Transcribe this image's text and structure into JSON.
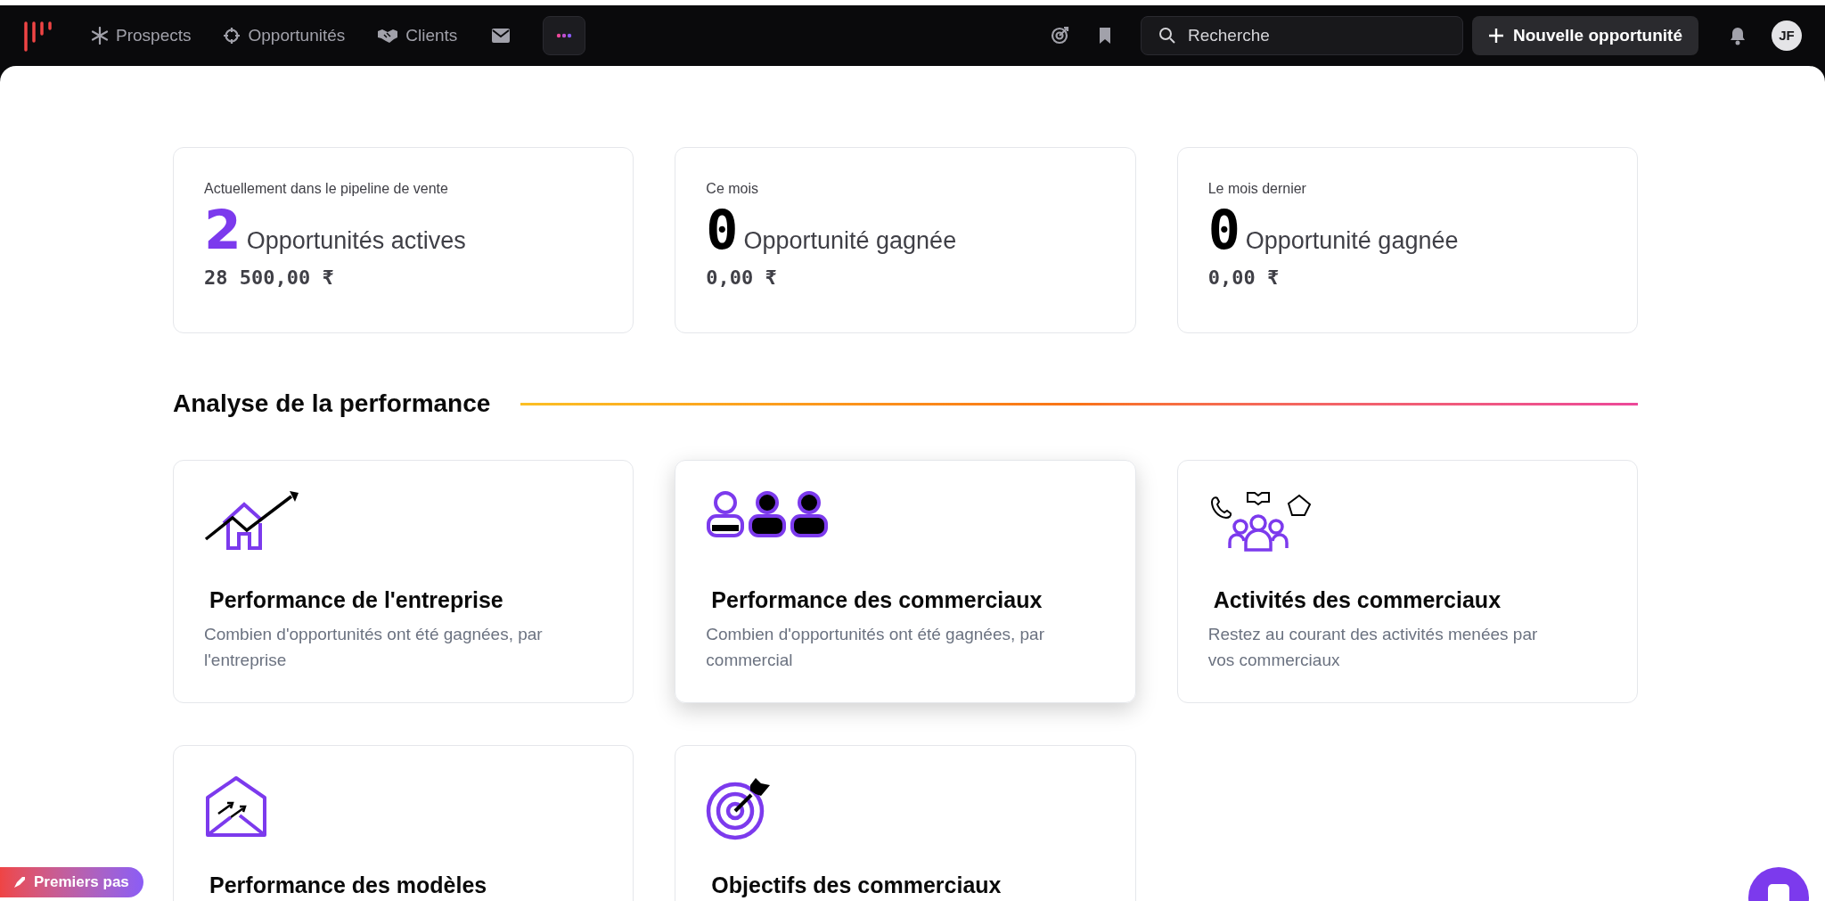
{
  "nav": {
    "items": [
      {
        "label": "Prospects"
      },
      {
        "label": "Opportunités"
      },
      {
        "label": "Clients"
      }
    ],
    "search": {
      "placeholder": "Recherche"
    },
    "new_button": "Nouvelle opportunité",
    "avatar": "JF"
  },
  "stats": [
    {
      "caption": "Actuellement dans le pipeline de vente",
      "count": "2",
      "highlighted": true,
      "label": "Opportunités actives",
      "amount": "28 500,00 ₹"
    },
    {
      "caption": "Ce mois",
      "count": "0",
      "highlighted": false,
      "label": "Opportunité gagnée",
      "amount": "0,00 ₹"
    },
    {
      "caption": "Le mois dernier",
      "count": "0",
      "highlighted": false,
      "label": "Opportunité gagnée",
      "amount": "0,00 ₹"
    }
  ],
  "section": {
    "title": "Analyse de la performance"
  },
  "reports": [
    {
      "title": "Performance de l'entreprise",
      "description": "Combien d'opportunités ont été gagnées, par l'entreprise",
      "hovered": false
    },
    {
      "title": "Performance des commerciaux",
      "description": "Combien d'opportunités ont été gagnées, par commercial",
      "hovered": true
    },
    {
      "title": "Activités des commerciaux",
      "description": "Restez au courant des activités menées par vos commerciaux",
      "hovered": false
    },
    {
      "title": "Performance des modèles",
      "hovered": false
    },
    {
      "title": "Objectifs des commerciaux",
      "hovered": false
    }
  ],
  "getting_started": "Premiers pas"
}
